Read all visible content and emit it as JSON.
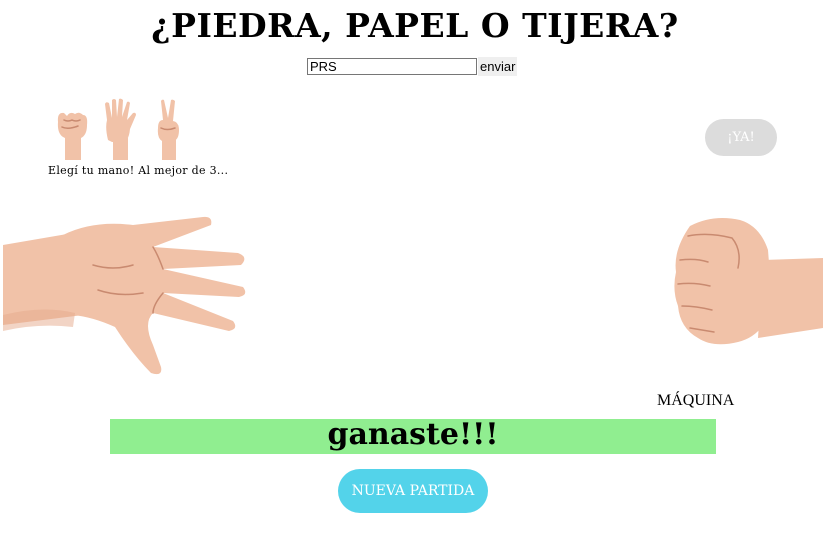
{
  "title": "¿PIEDRA, PAPEL O TIJERA?",
  "name_input": {
    "value": "PRS"
  },
  "send_button": {
    "label": "enviar"
  },
  "choices": [
    {
      "name": "piedra",
      "icon": "rock-hand-icon"
    },
    {
      "name": "papel",
      "icon": "paper-hand-icon"
    },
    {
      "name": "tijera",
      "icon": "scissors-hand-icon"
    }
  ],
  "instructions": "Elegí tu mano! Al mejor de 3...",
  "ya_button": {
    "label": "¡YA!"
  },
  "player_hand": "paper-hand-icon",
  "machine_hand": "rock-hand-icon",
  "machine_label": "MÁQUINA",
  "result": {
    "text": "ganaste!!!",
    "color": "#90ee90"
  },
  "new_game_button": {
    "label": "NUEVA PARTIDA",
    "color": "#53d3ea"
  }
}
